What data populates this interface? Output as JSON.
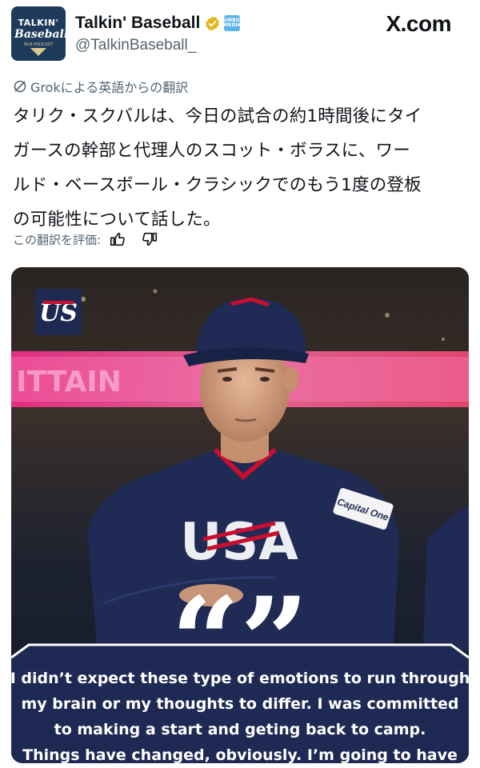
{
  "account": {
    "display_name": "Talkin' Baseball",
    "handle": "@TalkinBaseball_",
    "avatar_text": [
      "TALKIN'",
      "Baseball",
      "MLB PODCAST"
    ],
    "affiliate_badge_text": "JOMBOY MEDIA",
    "verified_color": "#e2b719"
  },
  "site_logo": "X.com",
  "translation": {
    "label": "Grokによる英語からの翻訳",
    "text_lines": [
      "タリク・スクバルは、今日の試合の約1時間後にタイ",
      "ガースの幹部と代理人のスコット・ボラスに、ワー",
      "ルド・ベースボール・クラシックでのもう1度の登板",
      "の可能性について話した。"
    ],
    "rate_label": "この翻訳を評価:"
  },
  "media": {
    "jersey_text": "USA",
    "sponsor_patch": "Capital One",
    "quote_mark": "“”",
    "quote_lines": [
      "I didn’t expect these type of emotions to run through",
      "my brain or my thoughts to differ. I was committed",
      "to making a start and geting back to camp.",
      "Things have changed, obviously. I’m going to have"
    ]
  },
  "colors": {
    "text_primary": "#0f1419",
    "text_secondary": "#536471",
    "usa_navy": "#1f2a55",
    "usa_red": "#c8102e",
    "neon_pink": "#ff4aa8"
  }
}
